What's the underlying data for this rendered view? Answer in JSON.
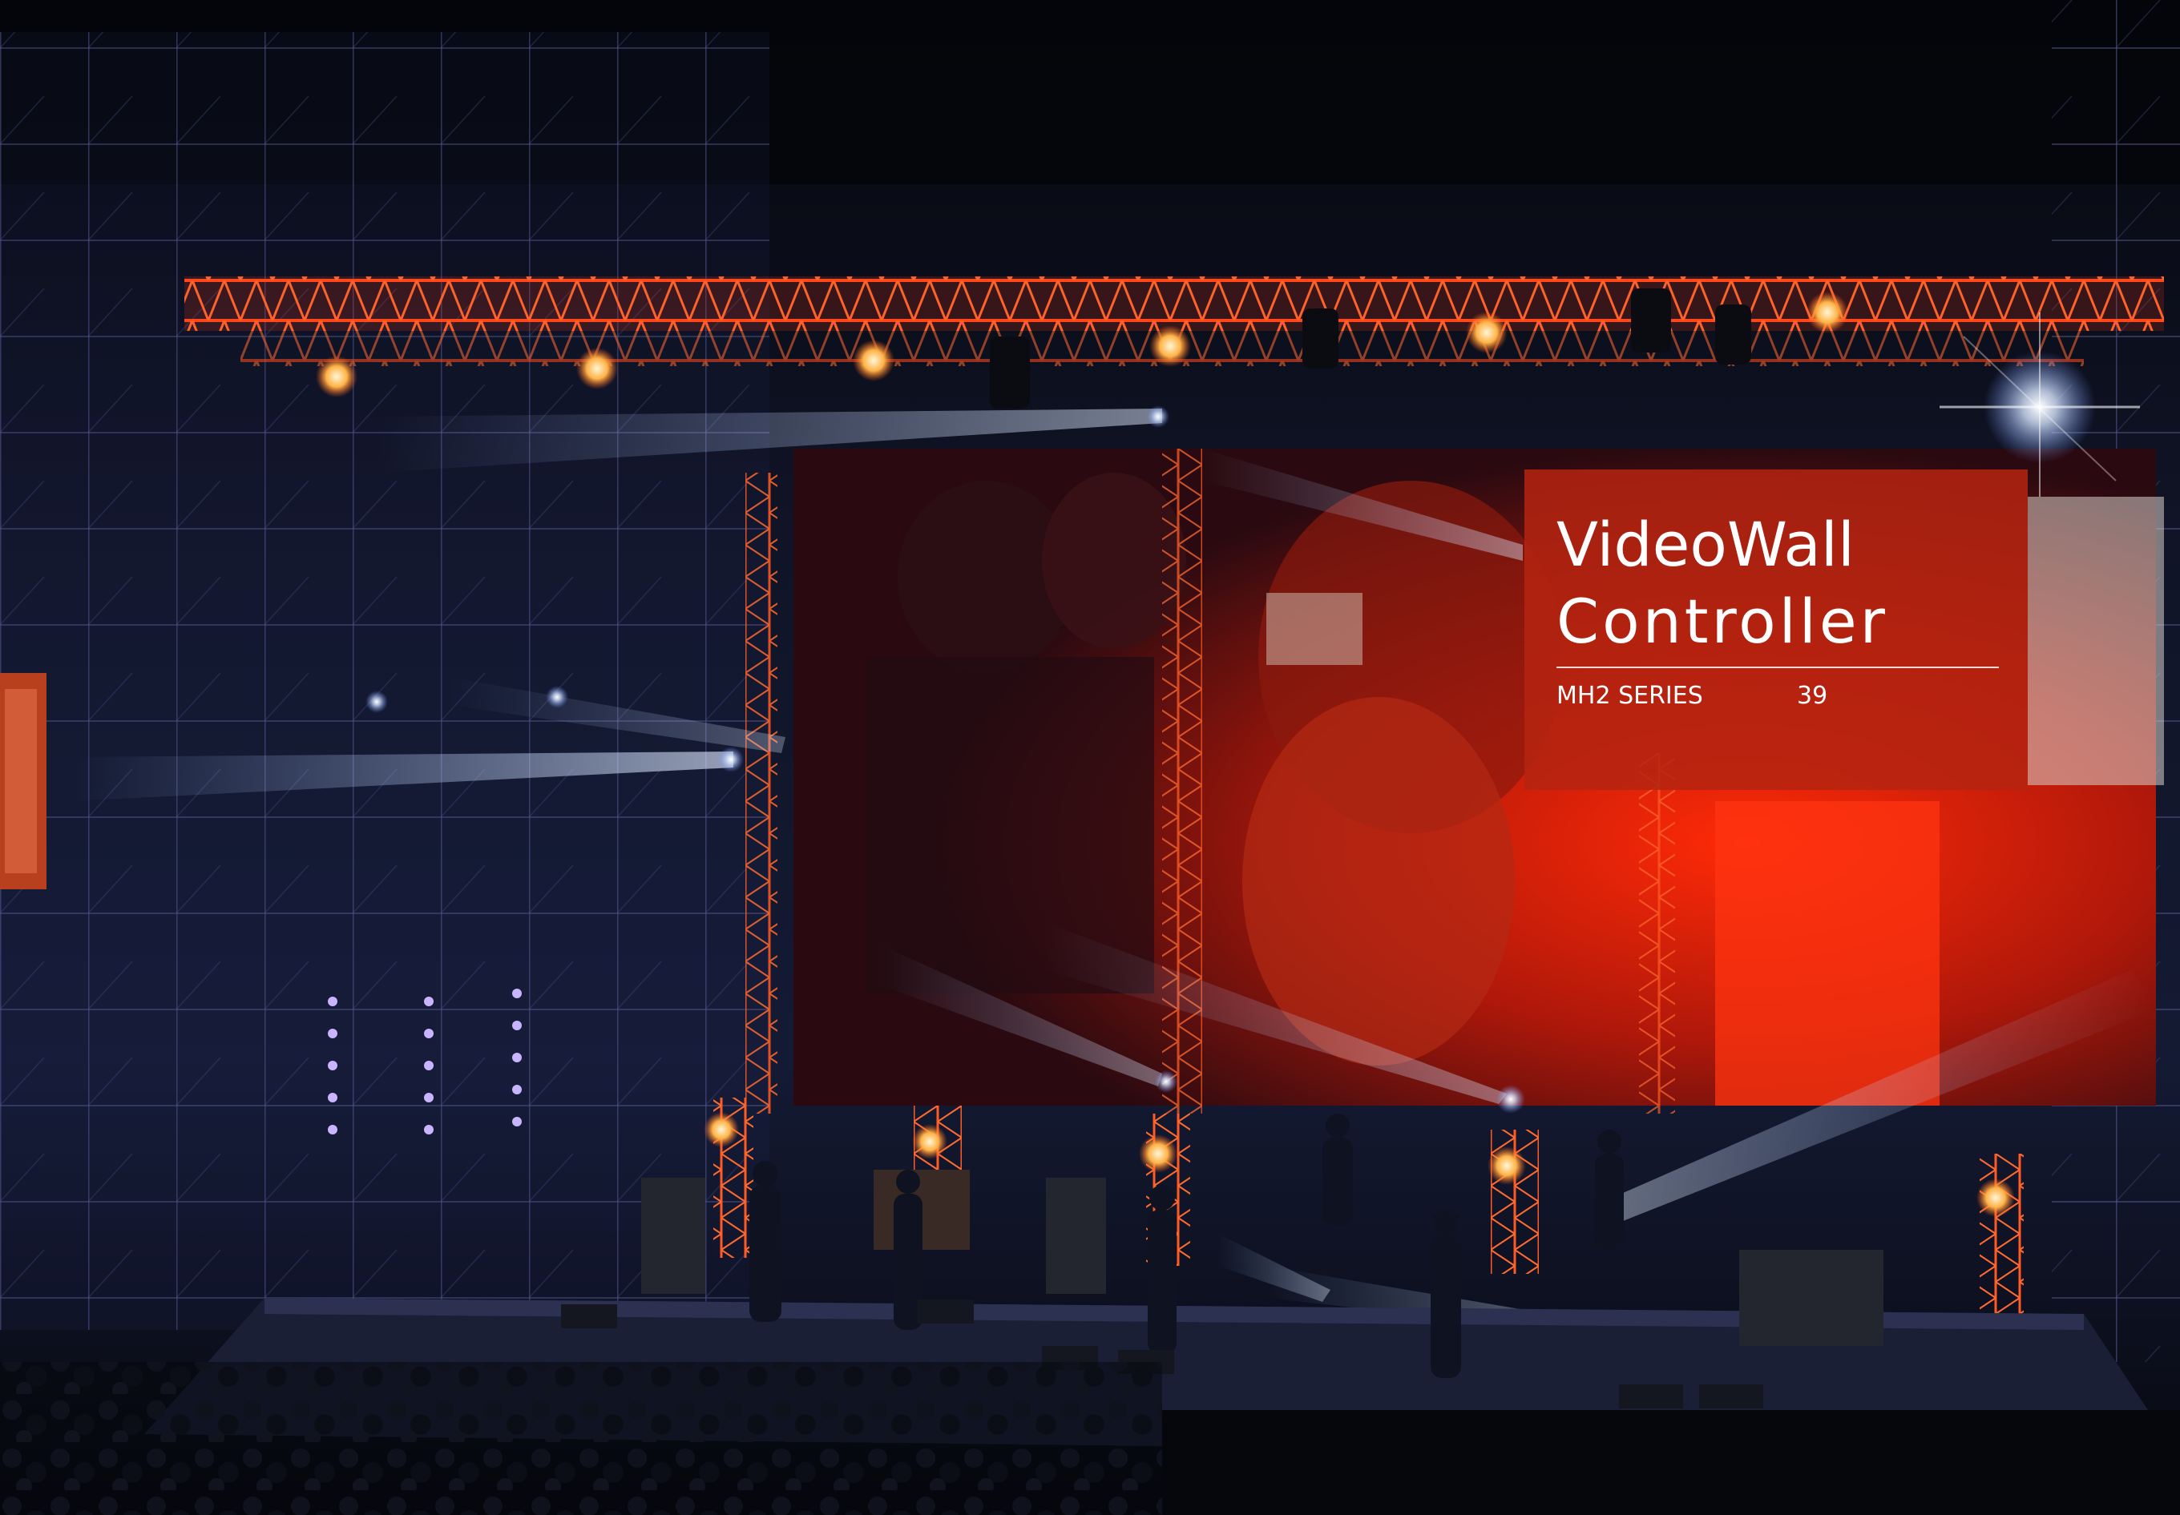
{
  "cover": {
    "title_line_1": "VideoWall",
    "title_line_2": "Controller",
    "series": "MH2 SERIES",
    "page_number": "39"
  },
  "colors": {
    "card_background": "#b42410",
    "truss_red": "#ff3b14",
    "beam_blue": "#a9c8ff",
    "background": "#07080f"
  },
  "image": {
    "subject": "concert-stage-photo"
  }
}
